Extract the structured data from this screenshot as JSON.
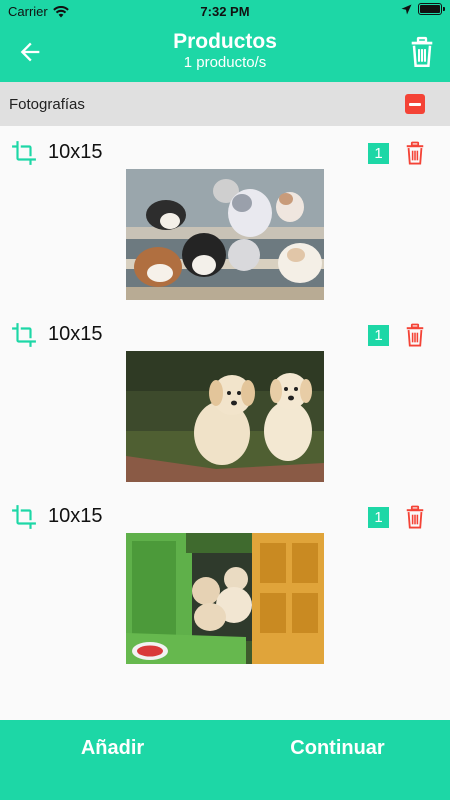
{
  "status_bar": {
    "carrier": "Carrier",
    "time": "7:32 PM"
  },
  "header": {
    "title": "Productos",
    "subtitle": "1 producto/s",
    "accent": "#1dd7a6"
  },
  "section": {
    "title": "Fotografías"
  },
  "items": [
    {
      "size": "10x15",
      "quantity": "1",
      "photo": "puppies-on-steps"
    },
    {
      "size": "10x15",
      "quantity": "1",
      "photo": "two-puppies-on-grass"
    },
    {
      "size": "10x15",
      "quantity": "1",
      "photo": "puppies-in-playhouse"
    }
  ],
  "footer": {
    "add_label": "Añadir",
    "continue_label": "Continuar"
  },
  "icons": {
    "back": "arrow-left-icon",
    "delete": "trash-icon",
    "remove": "minus-icon",
    "crop": "crop-icon",
    "wifi": "wifi-icon",
    "location": "location-arrow-icon",
    "battery": "battery-icon"
  },
  "colors": {
    "delete_red": "#f44336",
    "section_bg": "#e0e0e0"
  }
}
